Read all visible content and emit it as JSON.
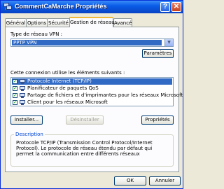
{
  "window": {
    "title": "CommentCaMarche Propriétés",
    "help_glyph": "?",
    "close_glyph": "✕"
  },
  "tabs": [
    {
      "label": "Général"
    },
    {
      "label": "Options"
    },
    {
      "label": "Sécurité"
    },
    {
      "label": "Gestion de réseau",
      "active": true
    },
    {
      "label": "Avancé"
    }
  ],
  "vpn": {
    "label": "Type de réseau VPN :",
    "selected": "PPTP VPN",
    "dropdown_glyph": "▼",
    "settings_button": "Paramètres"
  },
  "components": {
    "label": "Cette connexion utilise les éléments suivants :",
    "check_glyph": "✓",
    "items": [
      {
        "label": "Protocole Internet (TCP/IP)",
        "checked": true,
        "selected": true,
        "icon": "network-protocol-icon"
      },
      {
        "label": "Planificateur de paquets QoS",
        "checked": true,
        "selected": false,
        "icon": "qos-icon"
      },
      {
        "label": "Partage de fichiers et d'imprimantes pour les réseaux Microsoft",
        "checked": true,
        "selected": false,
        "icon": "file-share-icon"
      },
      {
        "label": "Client pour les réseaux Microsoft",
        "checked": true,
        "selected": false,
        "icon": "network-client-icon"
      }
    ],
    "install_button": "Installer...",
    "uninstall_button": "Désinstaller",
    "properties_button": "Propriétés"
  },
  "description": {
    "legend": "Description",
    "text": "Protocole TCP/IP (Transmission Control Protocol/Internet Protocol). Le protocole de réseau étendu par défaut qui permet la communication entre différents réseaux"
  },
  "footer": {
    "ok_button": "OK",
    "cancel_button": "Annuler"
  },
  "colors": {
    "titlebar": "#0a5ce8",
    "selection": "#316ac5",
    "dialog_bg": "#ece9d8",
    "legend_text": "#0046d5"
  }
}
